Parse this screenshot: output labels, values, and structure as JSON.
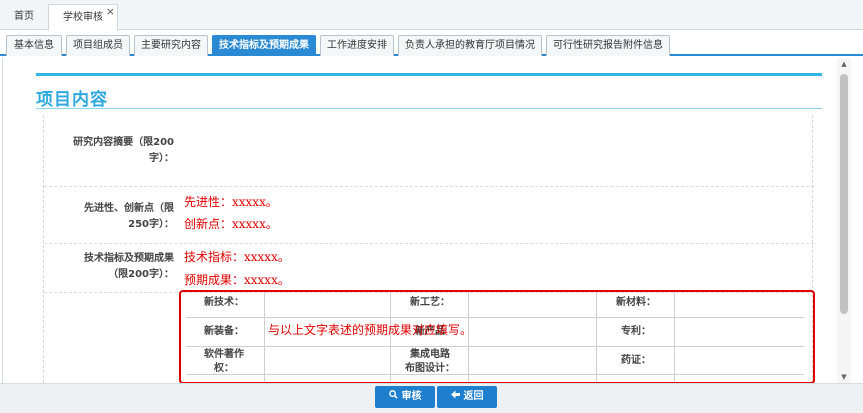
{
  "window_tabs": [
    {
      "label": "首页"
    },
    {
      "label": "学校审核",
      "close": "×"
    }
  ],
  "content_tabs": [
    {
      "label": "基本信息"
    },
    {
      "label": "项目组成员"
    },
    {
      "label": "主要研究内容"
    },
    {
      "label": "技术指标及预期成果"
    },
    {
      "label": "工作进度安排"
    },
    {
      "label": "负责人承担的教育厅项目情况"
    },
    {
      "label": "可行性研究报告附件信息"
    }
  ],
  "section_title": "项目内容",
  "rows": [
    {
      "label_line1": "研究内容摘要（限200",
      "label_line2": "字）："
    },
    {
      "label_line1": "先进性、创新点（限",
      "label_line2": "250字）：",
      "content": [
        "先进性：xxxxx。",
        "创新点：xxxxx。"
      ]
    },
    {
      "label_line1": "技术指标及预期成果",
      "label_line2": "（限200字）：",
      "content": [
        "技术指标：xxxxx。",
        "预期成果：xxxxx。"
      ]
    }
  ],
  "grid": {
    "row1": [
      "新技术：",
      "新工艺：",
      "新材料："
    ],
    "row2": [
      "新装备：",
      "新产品",
      "专利："
    ],
    "row3": [
      "软件著作",
      "权：",
      "集成电路",
      "布图设计：",
      "药证："
    ]
  },
  "overlay_note": "与以上文字表述的预期成果对应填写。",
  "buttons": {
    "review": "审核",
    "back": "返回"
  },
  "icons": {
    "review": "search-icon",
    "back": "arrow-left-icon"
  },
  "colors": {
    "accent": "#2a8ad4",
    "title": "#2fa8e0",
    "annotation": "#e00000"
  }
}
